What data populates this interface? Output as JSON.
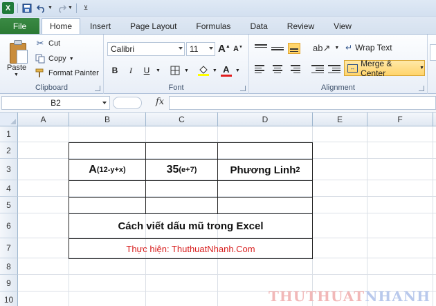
{
  "app": {
    "logo": "X"
  },
  "tabs": [
    {
      "label": "File"
    },
    {
      "label": "Home"
    },
    {
      "label": "Insert"
    },
    {
      "label": "Page Layout"
    },
    {
      "label": "Formulas"
    },
    {
      "label": "Data"
    },
    {
      "label": "Review"
    },
    {
      "label": "View"
    }
  ],
  "ribbon": {
    "clipboard": {
      "label": "Clipboard",
      "paste": "Paste",
      "cut": "Cut",
      "copy": "Copy",
      "format_painter": "Format Painter"
    },
    "font": {
      "label": "Font",
      "family": "Calibri",
      "size": "11",
      "bold": "B",
      "italic": "I",
      "underline": "U",
      "grow": "A",
      "shrink": "A",
      "font_color_letter": "A"
    },
    "alignment": {
      "label": "Alignment",
      "wrap_text": "Wrap Text",
      "merge_center": "Merge & Center"
    }
  },
  "formula_bar": {
    "name_box": "B2",
    "fx": "fx",
    "formula": ""
  },
  "columns": [
    "A",
    "B",
    "C",
    "D",
    "E",
    "F"
  ],
  "rows": [
    "1",
    "2",
    "3",
    "4",
    "5",
    "6",
    "7",
    "8",
    "9",
    "10"
  ],
  "cells": {
    "b3": {
      "base": "A",
      "sup": "(12-y+x)"
    },
    "c3": {
      "base": "35",
      "sup": "(e+7)"
    },
    "d3": {
      "base": "Phương Linh",
      "sup": "2"
    },
    "b6": "Cách viết dấu mũ trong Excel",
    "b7": "Thực hiện: ThuthuatNhanh.Com"
  },
  "watermark": {
    "part1": "THUTHUAT",
    "part2": "NHANH"
  },
  "colors": {
    "file_tab": "#2b7a34",
    "merge_highlight": "#ffd46b",
    "credit_text": "#d81e1e"
  }
}
